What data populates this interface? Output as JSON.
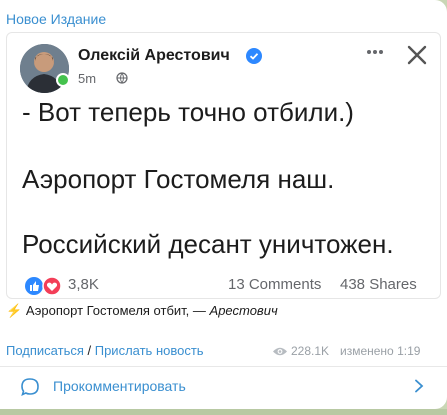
{
  "channel": {
    "name": "Новое Издание"
  },
  "post": {
    "author": "Олексій Арестович",
    "time": "5m",
    "lines": [
      "- Вот теперь точно отбили.)",
      "Аэропорт Гостомеля наш.",
      "Российский десант уничтожен."
    ],
    "reactions_count": "3,8K",
    "comments": "13 Comments",
    "shares": "438 Shares"
  },
  "caption": {
    "bolt": "⚡",
    "text": "Аэропорт Гостомеля отбит, —",
    "author_italic": "Арестович"
  },
  "footer": {
    "subscribe": "Подписаться",
    "separator": " / ",
    "send_news": "Прислать новость",
    "views": "228.1K",
    "edited": "изменено 1:19"
  },
  "comment_bar": {
    "label": "Прокомментировать"
  },
  "colors": {
    "accent": "#3a8fd0",
    "background": "#c9d6b5",
    "online": "#44c24d",
    "verified": "#2d88ff"
  }
}
